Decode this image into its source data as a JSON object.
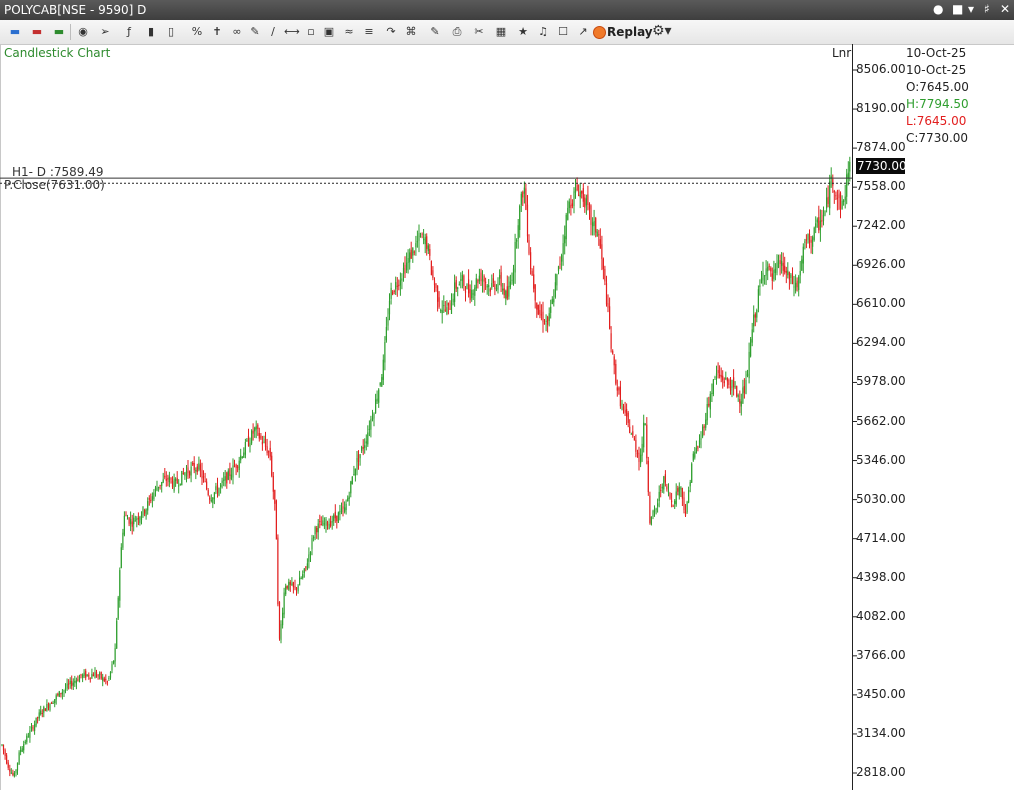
{
  "window": {
    "title": "POLYCAB[NSE - 9590] D",
    "controls": [
      "user-icon",
      "pin-icon",
      "dropdown-icon",
      "close-icon"
    ]
  },
  "toolbar": {
    "replay_label": "Replay",
    "icons": [
      "cursor-icon",
      "line-icon",
      "indicator-icon",
      "draw-icon",
      "zoom-icon",
      "settings-icon"
    ]
  },
  "chart": {
    "name": "Candlestick Chart",
    "scale_mode": "Lnr",
    "colors": {
      "up": "#2e9e2e",
      "down": "#e21e1e",
      "axis": "#222222"
    },
    "hline": {
      "label": "H1- D :7589.49",
      "value": 7589.49
    },
    "pclose": {
      "label": "P.Close(7631.00)",
      "value": 7631.0
    },
    "last_price_tag": "7730.00"
  },
  "ohlc": {
    "date1": "10-Oct-25",
    "date2": "10-Oct-25",
    "open": "O:7645.00",
    "high": "H:7794.50",
    "low": "L:7645.00",
    "close": "C:7730.00"
  },
  "chart_data": {
    "type": "candlestick",
    "y_axis_labels": [
      "8506.00",
      "8190.00",
      "7874.00",
      "7558.00",
      "7242.00",
      "6926.00",
      "6610.00",
      "6294.00",
      "5978.00",
      "5662.00",
      "5346.00",
      "5030.00",
      "4714.00",
      "4398.00",
      "4082.00",
      "3766.00",
      "3450.00",
      "3134.00",
      "2818.00"
    ],
    "ylim": [
      2740,
      8650
    ],
    "anchors": [
      [
        0,
        3100
      ],
      [
        8,
        2880
      ],
      [
        14,
        2780
      ],
      [
        20,
        3000
      ],
      [
        28,
        3120
      ],
      [
        40,
        3300
      ],
      [
        52,
        3400
      ],
      [
        65,
        3500
      ],
      [
        80,
        3600
      ],
      [
        95,
        3620
      ],
      [
        108,
        3550
      ],
      [
        115,
        3780
      ],
      [
        120,
        4500
      ],
      [
        124,
        4900
      ],
      [
        132,
        4850
      ],
      [
        145,
        4950
      ],
      [
        158,
        5150
      ],
      [
        168,
        5200
      ],
      [
        175,
        5150
      ],
      [
        185,
        5250
      ],
      [
        198,
        5300
      ],
      [
        210,
        5050
      ],
      [
        222,
        5150
      ],
      [
        235,
        5300
      ],
      [
        245,
        5450
      ],
      [
        255,
        5600
      ],
      [
        262,
        5500
      ],
      [
        270,
        5400
      ],
      [
        276,
        4850
      ],
      [
        279,
        3850
      ],
      [
        285,
        4350
      ],
      [
        295,
        4300
      ],
      [
        305,
        4450
      ],
      [
        315,
        4800
      ],
      [
        330,
        4850
      ],
      [
        345,
        4950
      ],
      [
        355,
        5300
      ],
      [
        365,
        5500
      ],
      [
        375,
        5800
      ],
      [
        383,
        6100
      ],
      [
        390,
        6700
      ],
      [
        398,
        6800
      ],
      [
        410,
        7000
      ],
      [
        420,
        7150
      ],
      [
        427,
        7100
      ],
      [
        432,
        6850
      ],
      [
        440,
        6600
      ],
      [
        448,
        6550
      ],
      [
        455,
        6750
      ],
      [
        462,
        6800
      ],
      [
        470,
        6700
      ],
      [
        480,
        6850
      ],
      [
        490,
        6750
      ],
      [
        500,
        6800
      ],
      [
        507,
        6650
      ],
      [
        513,
        6900
      ],
      [
        518,
        7300
      ],
      [
        524,
        7580
      ],
      [
        530,
        6950
      ],
      [
        538,
        6550
      ],
      [
        548,
        6450
      ],
      [
        554,
        6700
      ],
      [
        560,
        6950
      ],
      [
        568,
        7400
      ],
      [
        578,
        7550
      ],
      [
        585,
        7450
      ],
      [
        592,
        7250
      ],
      [
        598,
        7200
      ],
      [
        606,
        6700
      ],
      [
        612,
        6200
      ],
      [
        618,
        5900
      ],
      [
        625,
        5700
      ],
      [
        632,
        5550
      ],
      [
        640,
        5350
      ],
      [
        645,
        5700
      ],
      [
        650,
        4850
      ],
      [
        656,
        4950
      ],
      [
        663,
        5200
      ],
      [
        672,
        5000
      ],
      [
        680,
        5150
      ],
      [
        686,
        4900
      ],
      [
        692,
        5350
      ],
      [
        700,
        5500
      ],
      [
        708,
        5800
      ],
      [
        716,
        6050
      ],
      [
        724,
        6000
      ],
      [
        732,
        5950
      ],
      [
        740,
        5850
      ],
      [
        746,
        5950
      ],
      [
        752,
        6400
      ],
      [
        760,
        6750
      ],
      [
        766,
        6950
      ],
      [
        772,
        6800
      ],
      [
        780,
        6950
      ],
      [
        790,
        6800
      ],
      [
        797,
        6750
      ],
      [
        805,
        7100
      ],
      [
        812,
        7150
      ],
      [
        818,
        7250
      ],
      [
        825,
        7350
      ],
      [
        832,
        7650
      ],
      [
        838,
        7450
      ],
      [
        843,
        7400
      ],
      [
        848,
        7700
      ],
      [
        851,
        7730
      ]
    ]
  }
}
